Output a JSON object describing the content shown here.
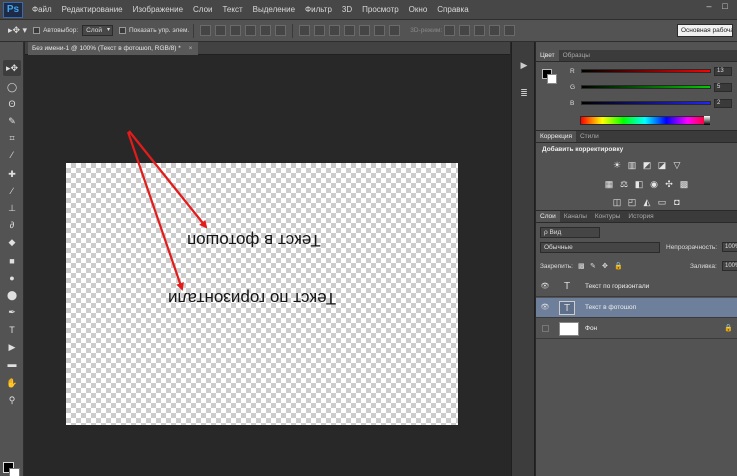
{
  "menu": {
    "logo": "Ps",
    "items": [
      "Файл",
      "Редактирование",
      "Изображение",
      "Слои",
      "Текст",
      "Выделение",
      "Фильтр",
      "3D",
      "Просмотр",
      "Окно",
      "Справка"
    ],
    "window_controls": [
      "–",
      "□"
    ]
  },
  "options": {
    "autoselect_label": "Автовыбор:",
    "autoselect_value": "Слой",
    "show_controls_label": "Показать упр. элем.",
    "mode_3d_label": "3D-режим:",
    "workspace": "Основная рабочая"
  },
  "tools": {
    "items": [
      {
        "name": "move-tool-icon",
        "glyph": "▸✥"
      },
      {
        "name": "marquee-tool-icon",
        "glyph": "◯"
      },
      {
        "name": "lasso-tool-icon",
        "glyph": "ʘ"
      },
      {
        "name": "quick-select-tool-icon",
        "glyph": "✎"
      },
      {
        "name": "crop-tool-icon",
        "glyph": "⌗"
      },
      {
        "name": "eyedropper-tool-icon",
        "glyph": "⁄"
      },
      {
        "name": "healing-tool-icon",
        "glyph": "✚"
      },
      {
        "name": "brush-tool-icon",
        "glyph": "∕"
      },
      {
        "name": "stamp-tool-icon",
        "glyph": "⊥"
      },
      {
        "name": "history-brush-tool-icon",
        "glyph": "∂"
      },
      {
        "name": "eraser-tool-icon",
        "glyph": "◆"
      },
      {
        "name": "gradient-tool-icon",
        "glyph": "■"
      },
      {
        "name": "blur-tool-icon",
        "glyph": "●"
      },
      {
        "name": "dodge-tool-icon",
        "glyph": "⬤"
      },
      {
        "name": "pen-tool-icon",
        "glyph": "✒"
      },
      {
        "name": "type-tool-icon",
        "glyph": "T"
      },
      {
        "name": "path-select-tool-icon",
        "glyph": "▶"
      },
      {
        "name": "shape-tool-icon",
        "glyph": "▬"
      },
      {
        "name": "hand-tool-icon",
        "glyph": "✋"
      },
      {
        "name": "zoom-tool-icon",
        "glyph": "⚲"
      }
    ]
  },
  "document": {
    "tab_title": "Без имени-1 @ 100% (Текст в фотошоп, RGB/8) *",
    "close": "×",
    "text_layer_1": "Текст в фотошоп",
    "text_layer_2": "Текст по горизонтали"
  },
  "dock": {
    "items": [
      {
        "name": "play-icon",
        "glyph": "▶"
      },
      {
        "name": "properties-icon",
        "glyph": "≣"
      }
    ]
  },
  "color_panel": {
    "tabs": [
      "Цвет",
      "Образцы"
    ],
    "channels": [
      {
        "label": "R",
        "value": "13",
        "color": "#e02424"
      },
      {
        "label": "G",
        "value": "5",
        "color": "#1fa52a"
      },
      {
        "label": "B",
        "value": "2",
        "color": "#2b38d8"
      }
    ]
  },
  "adjustments_panel": {
    "tabs": [
      "Коррекция",
      "Стили"
    ],
    "title": "Добавить корректировку",
    "icons_row1": [
      {
        "name": "brightness-icon",
        "glyph": "☀"
      },
      {
        "name": "levels-icon",
        "glyph": "▥"
      },
      {
        "name": "curves-icon",
        "glyph": "◩"
      },
      {
        "name": "exposure-icon",
        "glyph": "◪"
      },
      {
        "name": "vibrance-icon",
        "glyph": "▽"
      }
    ],
    "icons_row2": [
      {
        "name": "hue-sat-icon",
        "glyph": "▦"
      },
      {
        "name": "color-balance-icon",
        "glyph": "⚖"
      },
      {
        "name": "bw-icon",
        "glyph": "◧"
      },
      {
        "name": "photo-filter-icon",
        "glyph": "◉"
      },
      {
        "name": "channel-mixer-icon",
        "glyph": "✣"
      },
      {
        "name": "color-lookup-icon",
        "glyph": "▩"
      }
    ],
    "icons_row3": [
      {
        "name": "invert-icon",
        "glyph": "◫"
      },
      {
        "name": "posterize-icon",
        "glyph": "◰"
      },
      {
        "name": "threshold-icon",
        "glyph": "◭"
      },
      {
        "name": "gradient-map-icon",
        "glyph": "▭"
      },
      {
        "name": "selective-color-icon",
        "glyph": "◘"
      }
    ]
  },
  "layers_panel": {
    "tabs": [
      "Слои",
      "Каналы",
      "Контуры",
      "История"
    ],
    "filter": "ρ Вид",
    "blend_mode": "Обычные",
    "opacity_label": "Непрозрачность:",
    "opacity_value": "100%",
    "lock_label": "Закрепить:",
    "fill_label": "Заливка:",
    "fill_value": "100%",
    "layers": [
      {
        "name": "Текст по горизонтали",
        "kind": "T",
        "visible": true,
        "selected": false
      },
      {
        "name": "Текст в фотошоп",
        "kind": "T",
        "visible": true,
        "selected": true
      },
      {
        "name": "Фон",
        "kind": "",
        "visible": false,
        "selected": false
      }
    ]
  },
  "colors": {
    "arrow": "#e41b1b",
    "selected_layer": "#6d7f9b"
  }
}
